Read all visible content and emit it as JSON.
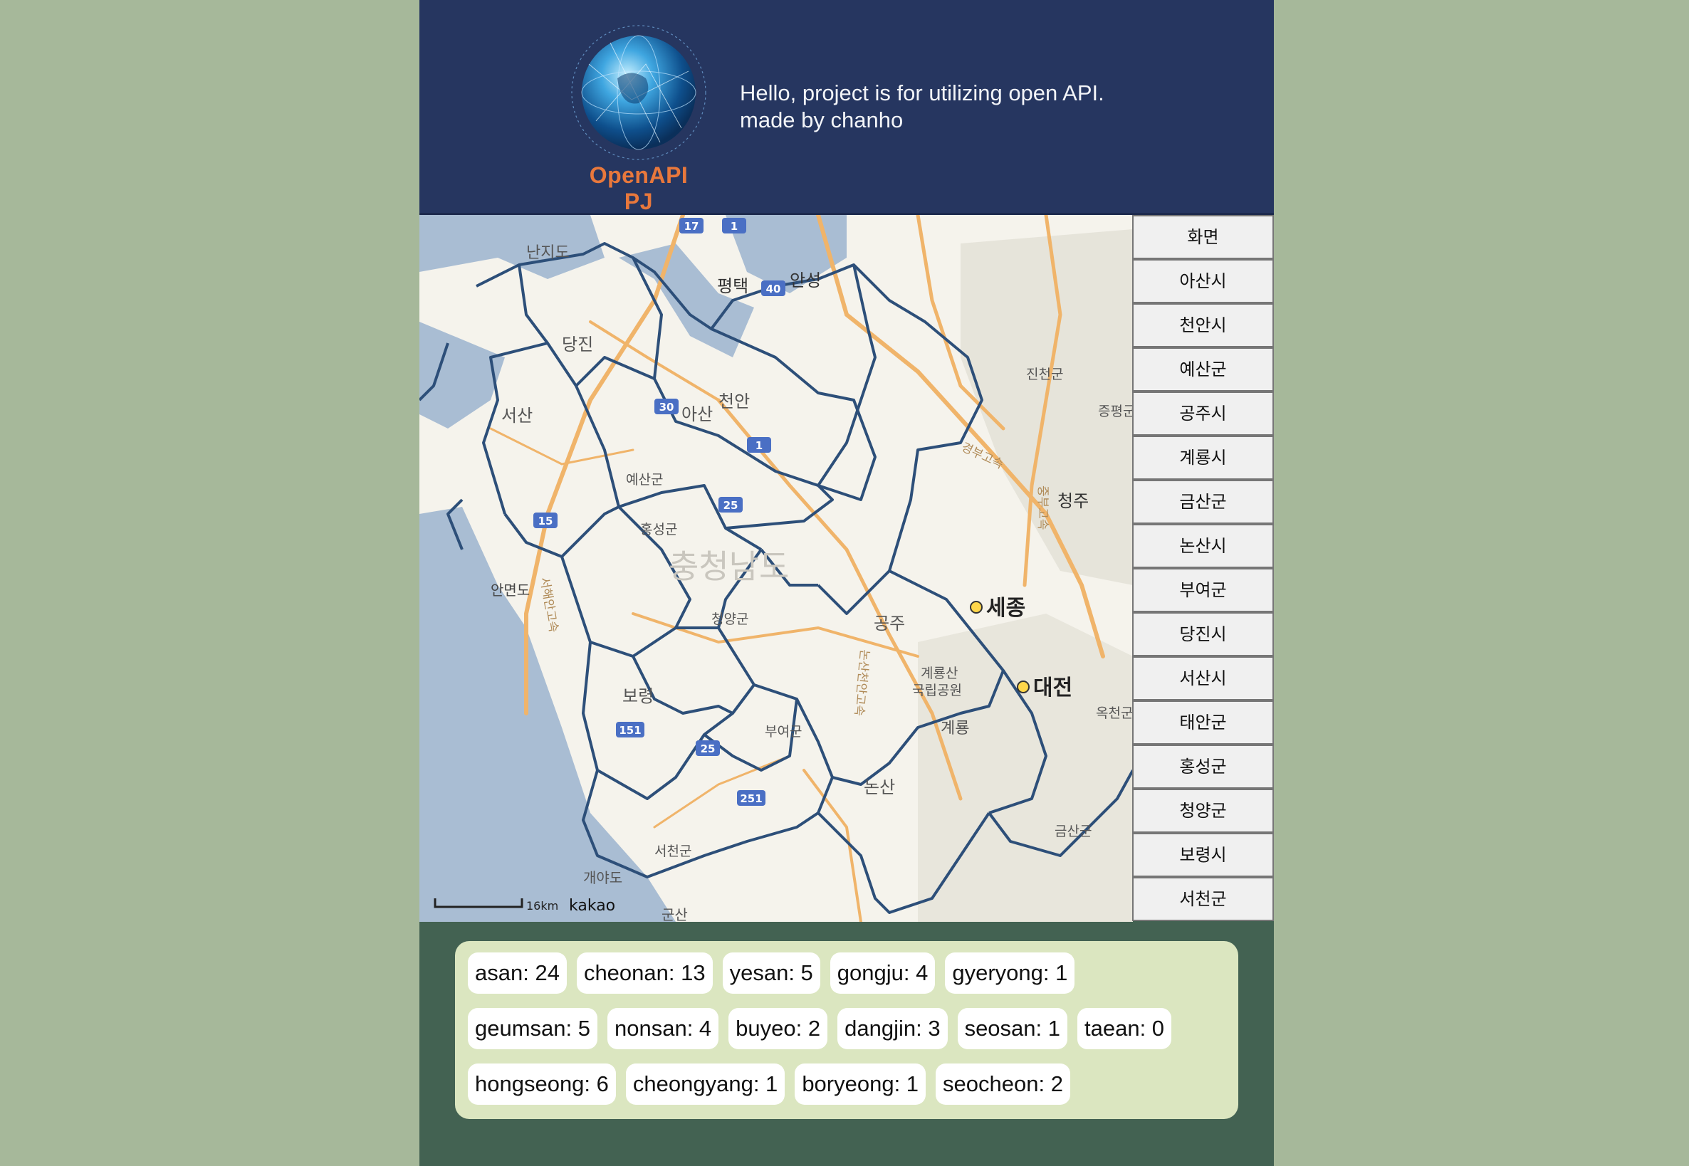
{
  "header": {
    "logo_text": "OpenAPI PJ",
    "line1": "Hello, project is for utilizing open API.",
    "line2": "made by chanho"
  },
  "map": {
    "attribution": "kakao",
    "scale_label": "16km",
    "region_label": "충청남도",
    "labels": {
      "nanjido": "난지도",
      "dangjin": "당진",
      "seosan": "서산",
      "asan": "아산",
      "cheonan": "천안",
      "pyeongtaek": "평택",
      "anseong": "안성",
      "jincheon": "진천군",
      "jeungpyeong": "증평군",
      "cheongju": "청주",
      "yesan": "예산군",
      "hongseong": "홍성군",
      "anmyeondo": "안면도",
      "cheongyang": "청양군",
      "gongju": "공주",
      "sejong": "세종",
      "daejeon": "대전",
      "boryeong": "보령",
      "buyeo": "부여군",
      "gyeryongsan": "계룡산",
      "gukrip": "국립공원",
      "gyeryong": "계룡",
      "okcheon": "옥천군",
      "nonsan": "논산",
      "seocheon": "서천군",
      "geumsan": "금산군",
      "gaeyado": "개야도",
      "gunsan": "군산",
      "expressway_seohaean": "서해안고속",
      "expressway_gyeongbu": "경부고속",
      "expressway_jungbu": "중부고속",
      "expressway_nonsan": "논산천안고속"
    },
    "highway_shields": [
      "17",
      "1",
      "40",
      "30",
      "1",
      "25",
      "15",
      "151",
      "25",
      "251"
    ]
  },
  "sidebar": {
    "buttons": [
      "화면",
      "아산시",
      "천안시",
      "예산군",
      "공주시",
      "계룡시",
      "금산군",
      "논산시",
      "부여군",
      "당진시",
      "서산시",
      "태안군",
      "홍성군",
      "청양군",
      "보령시",
      "서천군"
    ]
  },
  "stats": [
    "asan: 24",
    "cheonan: 13",
    "yesan: 5",
    "gongju: 4",
    "gyeryong: 1",
    "geumsan: 5",
    "nonsan: 4",
    "buyeo: 2",
    "dangjin: 3",
    "seosan: 1",
    "taean: 0",
    "hongseong: 6",
    "cheongyang: 1",
    "boryeong: 1",
    "seocheon: 2"
  ],
  "colors": {
    "page_bg": "#a6b89a",
    "header_bg": "#263660",
    "logo_text": "#e8783c",
    "footer_bg": "#436252",
    "stats_bg": "#dbe6c0",
    "boundary": "#2d4f79",
    "sea": "#a9bdd3"
  }
}
